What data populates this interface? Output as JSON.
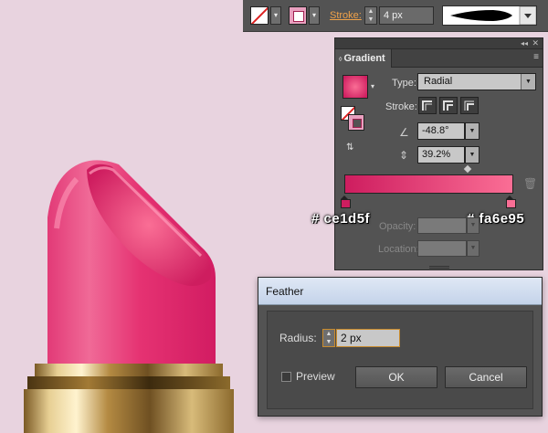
{
  "toolbar": {
    "fill_icon": "none-fill-swatch-icon",
    "stroke_icon": "stroke-swatch-icon",
    "stroke_label": "Stroke:",
    "stroke_weight": "4 px",
    "brush_icon": "brush-definition-icon"
  },
  "gradient_panel": {
    "tab_title": "Gradient",
    "tab_arrows": "◊",
    "collapse": "◂◂",
    "close": "✕",
    "menu": "≡",
    "type_label": "Type:",
    "type_value": "Radial",
    "stroke_label": "Stroke:",
    "angle_value": "-48.8°",
    "aspect_value": "39.2%",
    "opacity_label": "Opacity:",
    "location_label": "Location:",
    "start_color": "#ce1d5f",
    "end_color": "#fa6e95",
    "start_hex_label": "# ce1d5f",
    "end_hex_label": "# fa6e95"
  },
  "feather_dialog": {
    "title": "Feather",
    "radius_label": "Radius:",
    "radius_value": "2 px",
    "preview_label": "Preview",
    "preview_checked": false,
    "ok_label": "OK",
    "cancel_label": "Cancel"
  },
  "colors": {
    "background": "#e8d3df",
    "lipstick_dark": "#ce1d5f",
    "lipstick_light": "#fa6e95",
    "gold": "#c9a55a"
  }
}
